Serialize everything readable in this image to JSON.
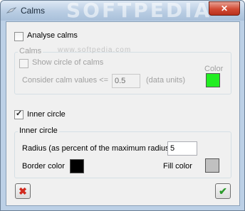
{
  "window": {
    "title": "Calms",
    "watermark": "SOFTPEDIA",
    "close_icon": "✕"
  },
  "analyse": {
    "label": "Analyse calms",
    "checked": false
  },
  "calms_group": {
    "title": "Calms",
    "show_circle_label": "Show circle of calms",
    "consider_label": "Consider calm values <=",
    "consider_value": "0.5",
    "units_label": "(data units)",
    "color_label": "Color",
    "color": "#22ee22",
    "watermark": "www.softpedia.com"
  },
  "inner_circle": {
    "checkbox_label": "Inner circle",
    "checked": true,
    "group_title": "Inner circle",
    "radius_label": "Radius (as percent of the maximum radius)",
    "radius_value": "5",
    "border_label": "Border color",
    "border_color": "#000000",
    "fill_label": "Fill color",
    "fill_color": "#c0c0c0"
  },
  "buttons": {
    "cancel_icon": "✖",
    "ok_icon": "✔"
  }
}
